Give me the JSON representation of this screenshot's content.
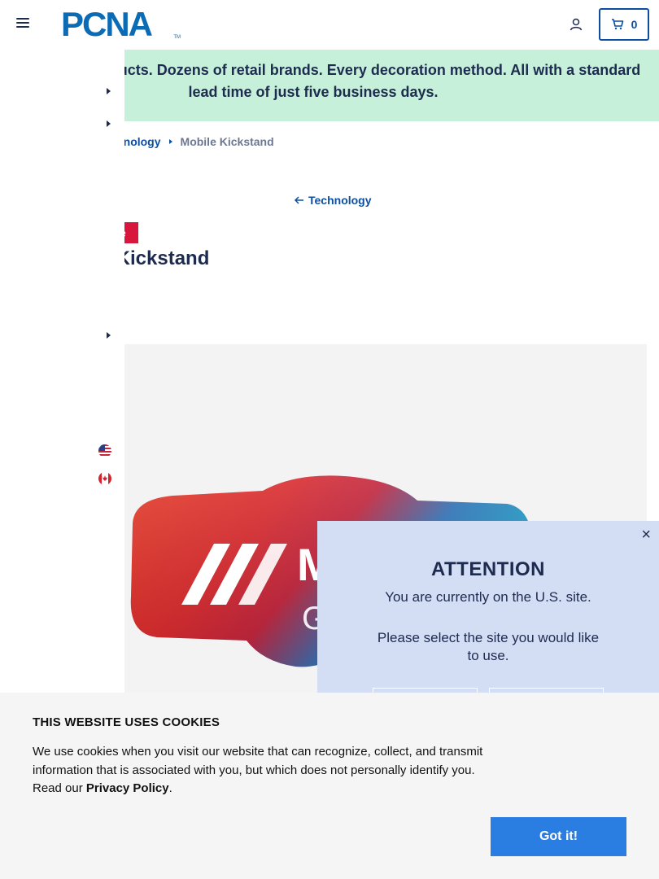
{
  "header": {
    "logo_text": "PCNA",
    "logo_tm": "TM",
    "cart_count": "0"
  },
  "banner": {
    "text": "Thousands of products. Dozens of retail brands. Every decoration method. All with a standard lead time of just five business days."
  },
  "breadcrumb": {
    "parent": "Technology",
    "current": "Mobile Kickstand"
  },
  "back_link": "Technology",
  "badge": "Sale",
  "product_title": "Mobile Kickstand",
  "modal": {
    "close": "×",
    "title": "ATTENTION",
    "line1": "You are currently on the U.S. site.",
    "line2": "Please select the site you would like to use."
  },
  "cookie": {
    "title": "THIS WEBSITE USES COOKIES",
    "text": "We use cookies when you visit our website that can recognize, collect, and transmit information that is associated with you, but which does not personally identify you. Read our ",
    "link": "Privacy Policy",
    "period": ".",
    "button": "Got it!"
  },
  "colors": {
    "brand_blue": "#0c6bb5",
    "banner_green": "#c6f0d9",
    "sale_red": "#d8173c",
    "modal_bg": "#d3ddf3",
    "cookie_button": "#2a7de1"
  }
}
